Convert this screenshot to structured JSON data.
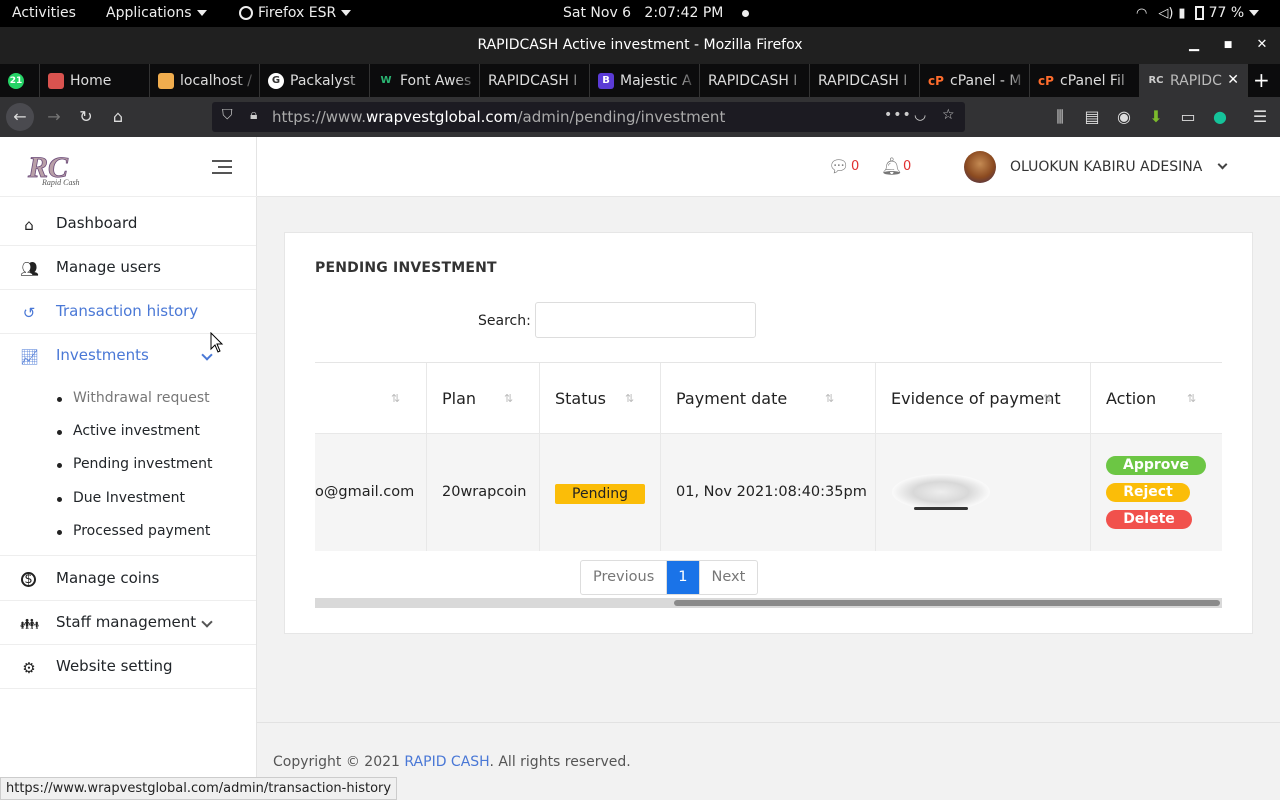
{
  "system_bar": {
    "activities": "Activities",
    "applications": "Applications",
    "browser_name": "Firefox ESR",
    "clock": "Sat Nov 6   2:07:42 PM",
    "battery": "77 %"
  },
  "window": {
    "title": "RAPIDCASH Active investment - Mozilla Firefox"
  },
  "tabs": [
    {
      "label": "21",
      "icon": "whatsapp-icon",
      "color": "#25d366"
    },
    {
      "label": "Home",
      "icon": "site-icon",
      "color": "#d9534f"
    },
    {
      "label": "localhost /",
      "icon": "phpmyadmin-icon",
      "color": "#f0ad4e"
    },
    {
      "label": "Packalyst",
      "icon": "google-icon",
      "color": "#ffffff"
    },
    {
      "label": "Font Awes",
      "icon": "wix-icon",
      "color": "#2bb673"
    },
    {
      "label": "RAPIDCASH I",
      "icon": "none",
      "color": "#0c0c0d"
    },
    {
      "label": "Majestic A",
      "icon": "bootstrap-icon",
      "color": "#5b3bd6"
    },
    {
      "label": "RAPIDCASH I",
      "icon": "none",
      "color": "#0c0c0d"
    },
    {
      "label": "RAPIDCASH I",
      "icon": "none",
      "color": "#0c0c0d"
    },
    {
      "label": "cPanel - M",
      "icon": "cpanel-icon",
      "color": "#ff6c2c"
    },
    {
      "label": "cPanel Fil",
      "icon": "cpanel-icon",
      "color": "#ff6c2c"
    },
    {
      "label": "RAPIDC",
      "icon": "rc-icon",
      "color": "#cccccc"
    }
  ],
  "url": {
    "prefix": "https://www.",
    "host": "wrapvestglobal.com",
    "path": "/admin/pending/investment"
  },
  "sidebar": {
    "items": [
      {
        "label": "Dashboard",
        "icon": "home-icon"
      },
      {
        "label": "Manage users",
        "icon": "users-icon"
      },
      {
        "label": "Transaction history",
        "icon": "history-icon"
      },
      {
        "label": "Investments",
        "icon": "chart-line-icon"
      },
      {
        "label": "Manage coins",
        "icon": "coin-icon"
      },
      {
        "label": "Staff management",
        "icon": "staff-icon"
      },
      {
        "label": "Website setting",
        "icon": "gear-icon"
      }
    ],
    "submenu": [
      "Withdrawal request",
      "Active investment",
      "Pending investment",
      "Due Investment",
      "Processed payment"
    ]
  },
  "header": {
    "message_count": "0",
    "notification_count": "0",
    "user_name": "OLUOKUN KABIRU ADESINA"
  },
  "card": {
    "title": "PENDING INVESTMENT",
    "search_label": "Search:"
  },
  "table": {
    "columns": [
      "",
      "Plan",
      "Status",
      "Payment date",
      "Evidence of payment",
      "Action"
    ],
    "rows": [
      {
        "email": "o@gmail.com",
        "plan": "20wrapcoin",
        "status": "Pending",
        "payment_date": "01, Nov 2021:08:40:35pm",
        "actions": [
          "Approve",
          "Reject",
          "Delete"
        ]
      }
    ]
  },
  "pagination": {
    "previous": "Previous",
    "current": "1",
    "next": "Next"
  },
  "footer": {
    "prefix": "Copyright © 2021 ",
    "brand": "RAPID CASH",
    "suffix": ". All rights reserved."
  },
  "status_url": "https://www.wrapvestglobal.com/admin/transaction-history",
  "colors": {
    "accent": "#4a78d6",
    "pending": "#fbbd08",
    "approve": "#6cc644",
    "delete": "#f1514c",
    "page_active": "#1a73e8"
  }
}
